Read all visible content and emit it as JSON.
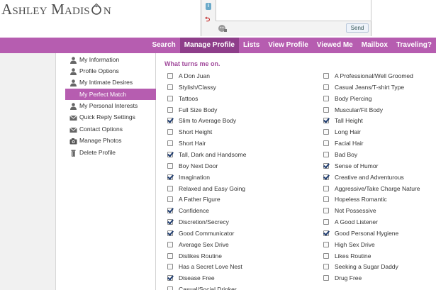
{
  "brand": {
    "logo_text_before": "Ashley Madis",
    "logo_text_after": "n"
  },
  "chat": {
    "send_label": "Send",
    "info_icon": "i",
    "key_icon": "key-icon"
  },
  "nav": {
    "items": [
      {
        "label": "Search",
        "active": false
      },
      {
        "label": "Manage Profile",
        "active": true
      },
      {
        "label": "Lists",
        "active": false
      },
      {
        "label": "View Profile",
        "active": false
      },
      {
        "label": "Viewed Me",
        "active": false
      },
      {
        "label": "Mailbox",
        "active": false
      },
      {
        "label": "Traveling?",
        "active": false
      }
    ]
  },
  "sidebar": {
    "items": [
      {
        "label": "My Information",
        "icon": "person-icon",
        "active": false
      },
      {
        "label": "Profile Options",
        "icon": "person-icon",
        "active": false
      },
      {
        "label": "My Intimate Desires",
        "icon": "person-icon",
        "active": false
      },
      {
        "label": "My Perfect Match",
        "icon": "person-icon",
        "active": true
      },
      {
        "label": "My Personal Interests",
        "icon": "person-icon",
        "active": false
      },
      {
        "label": "Quick Reply Settings",
        "icon": "envelope-icon",
        "active": false
      },
      {
        "label": "Contact Options",
        "icon": "envelope-icon",
        "active": false
      },
      {
        "label": "Manage Photos",
        "icon": "camera-icon",
        "active": false
      },
      {
        "label": "Delete Profile",
        "icon": "trash-icon",
        "active": false
      }
    ]
  },
  "main": {
    "title": "What turns me on.",
    "left_options": [
      {
        "label": "A Don Juan",
        "checked": false
      },
      {
        "label": "Stylish/Classy",
        "checked": false
      },
      {
        "label": "Tattoos",
        "checked": false
      },
      {
        "label": "Full Size Body",
        "checked": false
      },
      {
        "label": "Slim to Average Body",
        "checked": true
      },
      {
        "label": "Short Height",
        "checked": false
      },
      {
        "label": "Short Hair",
        "checked": false
      },
      {
        "label": "Tall, Dark and Handsome",
        "checked": true
      },
      {
        "label": "Boy Next Door",
        "checked": false
      },
      {
        "label": "Imagination",
        "checked": true
      },
      {
        "label": "Relaxed and Easy Going",
        "checked": false
      },
      {
        "label": "A Father Figure",
        "checked": false
      },
      {
        "label": "Confidence",
        "checked": true
      },
      {
        "label": "Discretion/Secrecy",
        "checked": true
      },
      {
        "label": "Good Communicator",
        "checked": true
      },
      {
        "label": "Average Sex Drive",
        "checked": false
      },
      {
        "label": "Dislikes Routine",
        "checked": false
      },
      {
        "label": "Has a Secret Love Nest",
        "checked": false
      },
      {
        "label": "Disease Free",
        "checked": true
      },
      {
        "label": "Casual/Social Drinker",
        "checked": false
      }
    ],
    "right_options": [
      {
        "label": "A Professional/Well Groomed",
        "checked": false
      },
      {
        "label": "Casual Jeans/T-shirt Type",
        "checked": false
      },
      {
        "label": "Body Piercing",
        "checked": false
      },
      {
        "label": "Muscular/Fit Body",
        "checked": false
      },
      {
        "label": "Tall Height",
        "checked": true
      },
      {
        "label": "Long Hair",
        "checked": false
      },
      {
        "label": "Facial Hair",
        "checked": false
      },
      {
        "label": "Bad Boy",
        "checked": false
      },
      {
        "label": "Sense of Humor",
        "checked": true
      },
      {
        "label": "Creative and Adventurous",
        "checked": true
      },
      {
        "label": "Aggressive/Take Charge Nature",
        "checked": false
      },
      {
        "label": "Hopeless Romantic",
        "checked": false
      },
      {
        "label": "Not Possessive",
        "checked": false
      },
      {
        "label": "A Good Listener",
        "checked": false
      },
      {
        "label": "Good Personal Hygiene",
        "checked": true
      },
      {
        "label": "High Sex Drive",
        "checked": false
      },
      {
        "label": "Likes Routine",
        "checked": false
      },
      {
        "label": "Seeking a Sugar Daddy",
        "checked": false
      },
      {
        "label": "Drug Free",
        "checked": false
      }
    ]
  },
  "colors": {
    "accent": "#b65db0",
    "accent_dark": "#8e3e8a",
    "title": "#a14a9c",
    "check": "#1c3a6e"
  }
}
